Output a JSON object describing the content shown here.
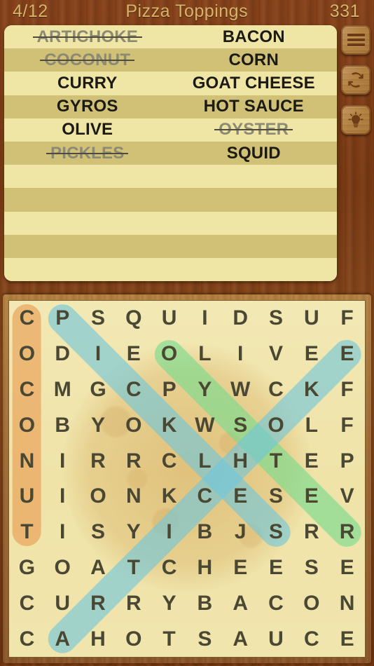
{
  "header": {
    "progress": "4/12",
    "title": "Pizza Toppings",
    "score": "331",
    "text_color": "#d6b468"
  },
  "side_buttons": [
    {
      "name": "menu-button",
      "icon": "hamburger-menu-icon",
      "label": "Menu"
    },
    {
      "name": "refresh-button",
      "icon": "refresh-icon",
      "label": "New Puzzle"
    },
    {
      "name": "hint-button",
      "icon": "lightbulb-icon",
      "label": "Hint"
    }
  ],
  "wordlist": {
    "stripe_light": "#efe6a5",
    "stripe_dark": "#d0c177",
    "found_color": "#8c8a74",
    "pending_color": "#1b1a14",
    "rows": [
      [
        {
          "word": "ARTICHOKE",
          "found": true
        },
        {
          "word": "BACON",
          "found": false
        }
      ],
      [
        {
          "word": "COCONUT",
          "found": true
        },
        {
          "word": "CORN",
          "found": false
        }
      ],
      [
        {
          "word": "CURRY",
          "found": false
        },
        {
          "word": "GOAT CHEESE",
          "found": false
        }
      ],
      [
        {
          "word": "GYROS",
          "found": false
        },
        {
          "word": "HOT SAUCE",
          "found": false
        }
      ],
      [
        {
          "word": "OLIVE",
          "found": false
        },
        {
          "word": "OYSTER",
          "found": true
        }
      ],
      [
        {
          "word": "PICKLES",
          "found": true
        },
        {
          "word": "SQUID",
          "found": false
        }
      ],
      [
        {
          "word": "",
          "found": false
        },
        {
          "word": "",
          "found": false
        }
      ],
      [
        {
          "word": "",
          "found": false
        },
        {
          "word": "",
          "found": false
        }
      ],
      [
        {
          "word": "",
          "found": false
        },
        {
          "word": "",
          "found": false
        }
      ],
      [
        {
          "word": "",
          "found": false
        },
        {
          "word": "",
          "found": false
        }
      ],
      [
        {
          "word": "",
          "found": false
        },
        {
          "word": "",
          "found": false
        }
      ]
    ]
  },
  "grid": {
    "rows": 10,
    "cols": 10,
    "letter_color": "#4a4733",
    "paper_color": "#f0e5ad",
    "letters": [
      [
        "C",
        "P",
        "S",
        "Q",
        "U",
        "I",
        "D",
        "S",
        "U",
        "F"
      ],
      [
        "O",
        "D",
        "I",
        "E",
        "O",
        "L",
        "I",
        "V",
        "E",
        "E"
      ],
      [
        "C",
        "M",
        "G",
        "C",
        "P",
        "Y",
        "W",
        "C",
        "K",
        "F"
      ],
      [
        "O",
        "B",
        "Y",
        "O",
        "K",
        "W",
        "S",
        "O",
        "L",
        "F"
      ],
      [
        "N",
        "I",
        "R",
        "R",
        "C",
        "L",
        "H",
        "T",
        "E",
        "P"
      ],
      [
        "U",
        "I",
        "O",
        "N",
        "K",
        "C",
        "E",
        "S",
        "E",
        "V"
      ],
      [
        "T",
        "I",
        "S",
        "Y",
        "I",
        "B",
        "J",
        "S",
        "R",
        "R"
      ],
      [
        "G",
        "O",
        "A",
        "T",
        "C",
        "H",
        "E",
        "E",
        "S",
        "E"
      ],
      [
        "C",
        "U",
        "R",
        "R",
        "Y",
        "B",
        "A",
        "C",
        "O",
        "N"
      ],
      [
        "C",
        "A",
        "H",
        "O",
        "T",
        "S",
        "A",
        "U",
        "C",
        "E"
      ]
    ],
    "highlights": [
      {
        "word": "COCONUT",
        "color": "#e89b50",
        "start": [
          0,
          0
        ],
        "end": [
          6,
          0
        ]
      },
      {
        "word": "PICKLES",
        "color": "#6fc6dc",
        "start": [
          0,
          1
        ],
        "end": [
          6,
          7
        ]
      },
      {
        "word": "OYSTER",
        "color": "#74dc8e",
        "start": [
          1,
          4
        ],
        "end": [
          6,
          9
        ]
      },
      {
        "word": "ARTICHOKE",
        "color": "#6fc6dc",
        "start": [
          1,
          9
        ],
        "end": [
          9,
          1
        ]
      }
    ]
  }
}
